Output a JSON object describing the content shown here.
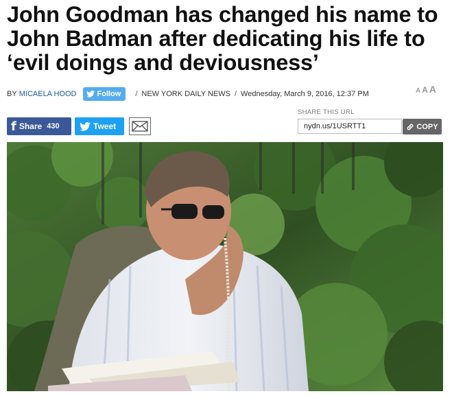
{
  "article": {
    "headline": "John Goodman has changed his name to John Badman after dedicating his life to ‘evil doings and deviousness’",
    "byline_prefix": "BY",
    "author": "MICAELA HOOD",
    "follow_label": "Follow",
    "separator": "/",
    "publication": "NEW YORK DAILY NEWS",
    "date": "Wednesday, March 9, 2016, 12:37 PM"
  },
  "font_size_controls": [
    "A",
    "A",
    "A"
  ],
  "share": {
    "facebook_label": "Share",
    "facebook_count": "430",
    "twitter_label": "Tweet",
    "url_label": "SHARE THIS URL",
    "url_value": "nydn.us/1USRTT1",
    "copy_label": "COPY"
  },
  "icons": {
    "twitter": "twitter-bird-icon",
    "facebook": "facebook-f-icon",
    "mail": "envelope-icon",
    "link": "link-icon"
  },
  "colors": {
    "twitter": "#55acee",
    "facebook": "#3b5998",
    "author_link": "#1a5aa8",
    "copy_button": "#666666"
  }
}
